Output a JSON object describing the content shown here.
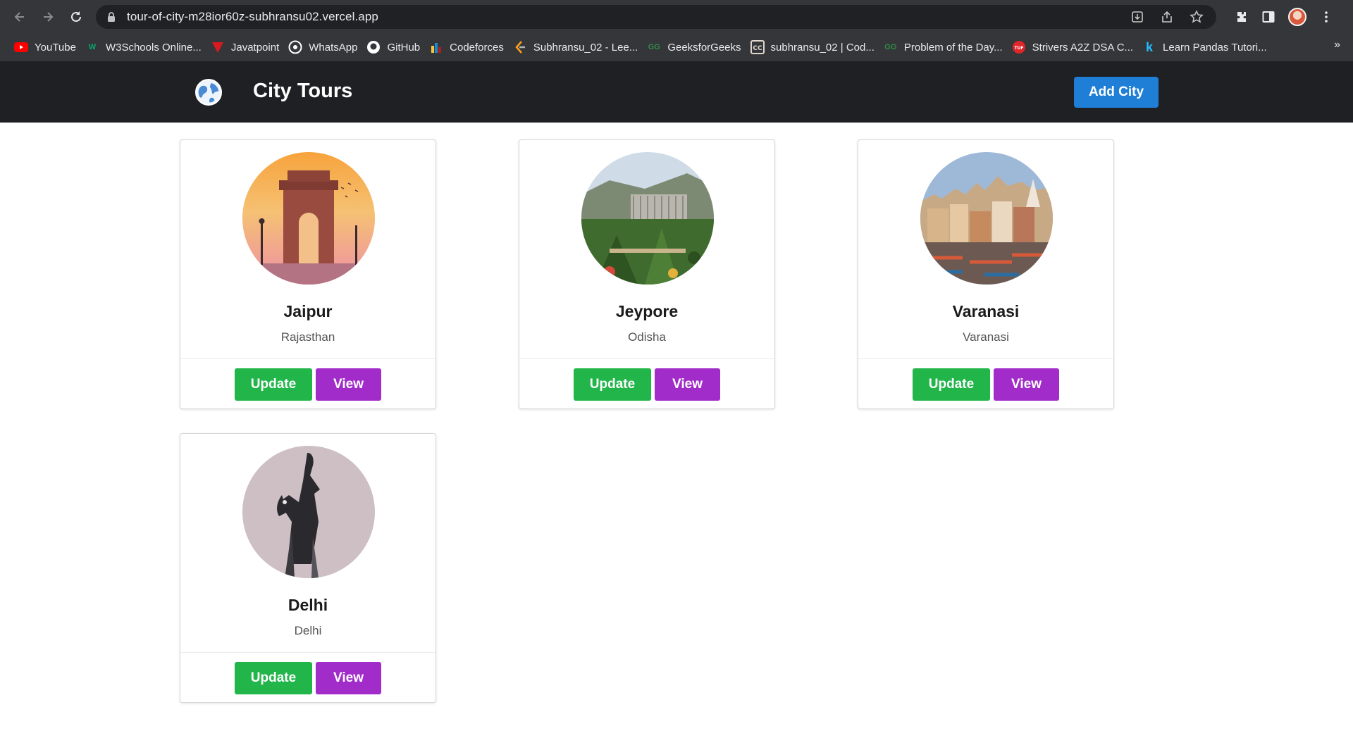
{
  "browser": {
    "url": "tour-of-city-m28ior60z-subhransu02.vercel.app",
    "bookmarks": [
      {
        "label": "YouTube",
        "icon": "youtube-icon"
      },
      {
        "label": "W3Schools Online...",
        "icon": "w3schools-icon"
      },
      {
        "label": "Javatpoint",
        "icon": "javatpoint-icon"
      },
      {
        "label": "WhatsApp",
        "icon": "whatsapp-icon"
      },
      {
        "label": "GitHub",
        "icon": "github-icon"
      },
      {
        "label": "Codeforces",
        "icon": "codeforces-icon"
      },
      {
        "label": "Subhransu_02 - Lee...",
        "icon": "leetcode-icon"
      },
      {
        "label": "GeeksforGeeks",
        "icon": "geeksforgeeks-icon"
      },
      {
        "label": "subhransu_02 | Cod...",
        "icon": "codechef-icon"
      },
      {
        "label": "Problem of the Day...",
        "icon": "geeksforgeeks-icon"
      },
      {
        "label": "Strivers A2Z DSA C...",
        "icon": "takeuforward-icon"
      },
      {
        "label": "Learn Pandas Tutori...",
        "icon": "kaggle-icon"
      }
    ],
    "more": "»"
  },
  "nav": {
    "title": "City Tours",
    "add_city": "Add City"
  },
  "cities": [
    {
      "name": "Jaipur",
      "state": "Rajasthan",
      "update": "Update",
      "view": "View"
    },
    {
      "name": "Jeypore",
      "state": "Odisha",
      "update": "Update",
      "view": "View"
    },
    {
      "name": "Varanasi",
      "state": "Varanasi",
      "update": "Update",
      "view": "View"
    },
    {
      "name": "Delhi",
      "state": "Delhi",
      "update": "Update",
      "view": "View"
    }
  ],
  "colors": {
    "navbar": "#1e2023",
    "add_city_button": "#1f7fd6",
    "update_button": "#21b54a",
    "view_button": "#a12cc9"
  }
}
